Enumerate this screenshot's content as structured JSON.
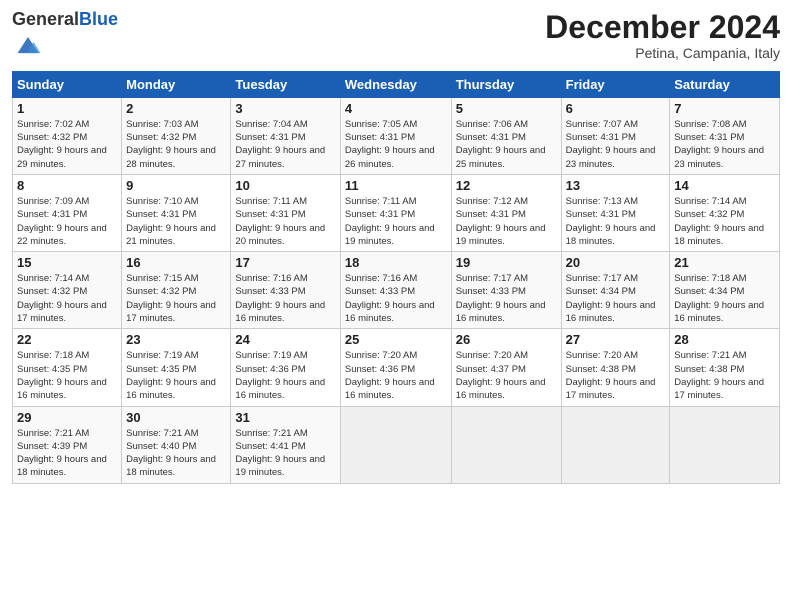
{
  "header": {
    "logo_general": "General",
    "logo_blue": "Blue",
    "month_title": "December 2024",
    "location": "Petina, Campania, Italy"
  },
  "weekdays": [
    "Sunday",
    "Monday",
    "Tuesday",
    "Wednesday",
    "Thursday",
    "Friday",
    "Saturday"
  ],
  "weeks": [
    [
      {
        "day": "1",
        "sunrise": "7:02 AM",
        "sunset": "4:32 PM",
        "daylight": "9 hours and 29 minutes."
      },
      {
        "day": "2",
        "sunrise": "7:03 AM",
        "sunset": "4:32 PM",
        "daylight": "9 hours and 28 minutes."
      },
      {
        "day": "3",
        "sunrise": "7:04 AM",
        "sunset": "4:31 PM",
        "daylight": "9 hours and 27 minutes."
      },
      {
        "day": "4",
        "sunrise": "7:05 AM",
        "sunset": "4:31 PM",
        "daylight": "9 hours and 26 minutes."
      },
      {
        "day": "5",
        "sunrise": "7:06 AM",
        "sunset": "4:31 PM",
        "daylight": "9 hours and 25 minutes."
      },
      {
        "day": "6",
        "sunrise": "7:07 AM",
        "sunset": "4:31 PM",
        "daylight": "9 hours and 23 minutes."
      },
      {
        "day": "7",
        "sunrise": "7:08 AM",
        "sunset": "4:31 PM",
        "daylight": "9 hours and 23 minutes."
      }
    ],
    [
      {
        "day": "8",
        "sunrise": "7:09 AM",
        "sunset": "4:31 PM",
        "daylight": "9 hours and 22 minutes."
      },
      {
        "day": "9",
        "sunrise": "7:10 AM",
        "sunset": "4:31 PM",
        "daylight": "9 hours and 21 minutes."
      },
      {
        "day": "10",
        "sunrise": "7:11 AM",
        "sunset": "4:31 PM",
        "daylight": "9 hours and 20 minutes."
      },
      {
        "day": "11",
        "sunrise": "7:11 AM",
        "sunset": "4:31 PM",
        "daylight": "9 hours and 19 minutes."
      },
      {
        "day": "12",
        "sunrise": "7:12 AM",
        "sunset": "4:31 PM",
        "daylight": "9 hours and 19 minutes."
      },
      {
        "day": "13",
        "sunrise": "7:13 AM",
        "sunset": "4:31 PM",
        "daylight": "9 hours and 18 minutes."
      },
      {
        "day": "14",
        "sunrise": "7:14 AM",
        "sunset": "4:32 PM",
        "daylight": "9 hours and 18 minutes."
      }
    ],
    [
      {
        "day": "15",
        "sunrise": "7:14 AM",
        "sunset": "4:32 PM",
        "daylight": "9 hours and 17 minutes."
      },
      {
        "day": "16",
        "sunrise": "7:15 AM",
        "sunset": "4:32 PM",
        "daylight": "9 hours and 17 minutes."
      },
      {
        "day": "17",
        "sunrise": "7:16 AM",
        "sunset": "4:33 PM",
        "daylight": "9 hours and 16 minutes."
      },
      {
        "day": "18",
        "sunrise": "7:16 AM",
        "sunset": "4:33 PM",
        "daylight": "9 hours and 16 minutes."
      },
      {
        "day": "19",
        "sunrise": "7:17 AM",
        "sunset": "4:33 PM",
        "daylight": "9 hours and 16 minutes."
      },
      {
        "day": "20",
        "sunrise": "7:17 AM",
        "sunset": "4:34 PM",
        "daylight": "9 hours and 16 minutes."
      },
      {
        "day": "21",
        "sunrise": "7:18 AM",
        "sunset": "4:34 PM",
        "daylight": "9 hours and 16 minutes."
      }
    ],
    [
      {
        "day": "22",
        "sunrise": "7:18 AM",
        "sunset": "4:35 PM",
        "daylight": "9 hours and 16 minutes."
      },
      {
        "day": "23",
        "sunrise": "7:19 AM",
        "sunset": "4:35 PM",
        "daylight": "9 hours and 16 minutes."
      },
      {
        "day": "24",
        "sunrise": "7:19 AM",
        "sunset": "4:36 PM",
        "daylight": "9 hours and 16 minutes."
      },
      {
        "day": "25",
        "sunrise": "7:20 AM",
        "sunset": "4:36 PM",
        "daylight": "9 hours and 16 minutes."
      },
      {
        "day": "26",
        "sunrise": "7:20 AM",
        "sunset": "4:37 PM",
        "daylight": "9 hours and 16 minutes."
      },
      {
        "day": "27",
        "sunrise": "7:20 AM",
        "sunset": "4:38 PM",
        "daylight": "9 hours and 17 minutes."
      },
      {
        "day": "28",
        "sunrise": "7:21 AM",
        "sunset": "4:38 PM",
        "daylight": "9 hours and 17 minutes."
      }
    ],
    [
      {
        "day": "29",
        "sunrise": "7:21 AM",
        "sunset": "4:39 PM",
        "daylight": "9 hours and 18 minutes."
      },
      {
        "day": "30",
        "sunrise": "7:21 AM",
        "sunset": "4:40 PM",
        "daylight": "9 hours and 18 minutes."
      },
      {
        "day": "31",
        "sunrise": "7:21 AM",
        "sunset": "4:41 PM",
        "daylight": "9 hours and 19 minutes."
      },
      null,
      null,
      null,
      null
    ]
  ]
}
